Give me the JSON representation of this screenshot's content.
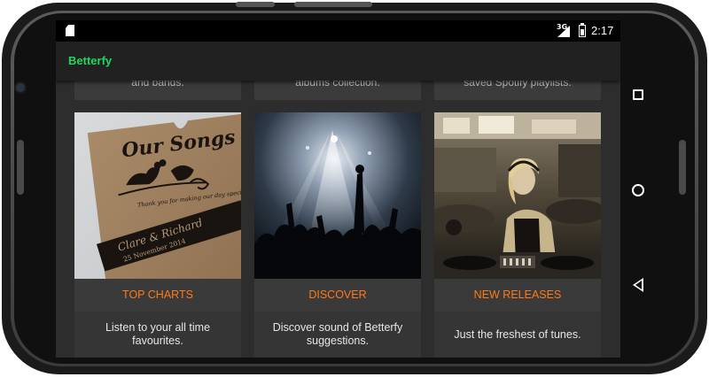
{
  "status_bar": {
    "network": "3G",
    "time": "2:17",
    "battery_level": 0.6
  },
  "app_bar": {
    "title": "Betterfy",
    "title_color": "#1ed760"
  },
  "previous_row": [
    {
      "text": "and bands."
    },
    {
      "text": "albums collection."
    },
    {
      "text": "saved Spotify playlists."
    }
  ],
  "cards": [
    {
      "title": "TOP CHARTS",
      "description": "Listen to your all time favourites.",
      "image": "our-songs-label-photo"
    },
    {
      "title": "DISCOVER",
      "description": "Discover sound of Betterfy suggestions.",
      "image": "concert-crowd-photo"
    },
    {
      "title": "NEW RELEASES",
      "description": "Just the freshest of tunes.",
      "image": "dj-turntables-photo"
    }
  ],
  "image_text": {
    "our_songs": "Our Songs",
    "thanks": "Thank you for making our day special",
    "names": "Clare & Richard",
    "date": "25 November 2014"
  },
  "nav_buttons": {
    "recents": "square-icon",
    "home": "circle-icon",
    "back": "triangle-back-icon"
  },
  "accent_color": "#ff7a1a"
}
